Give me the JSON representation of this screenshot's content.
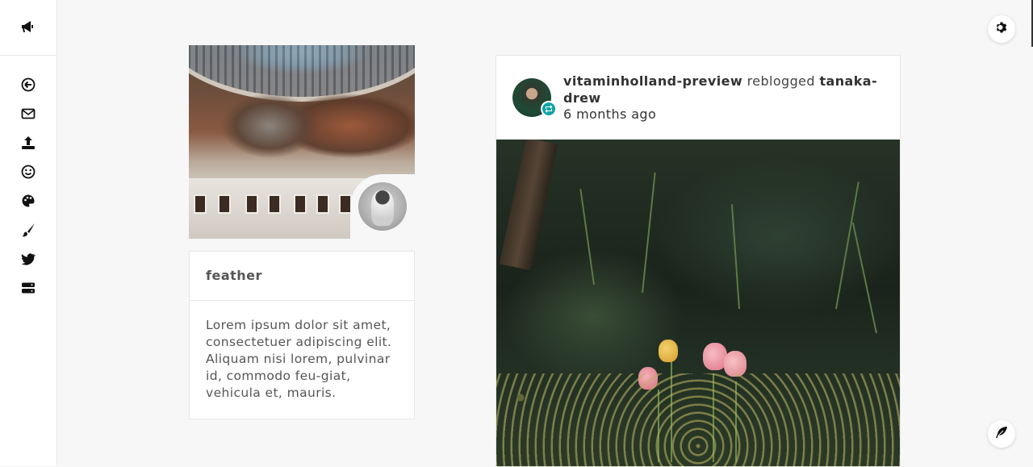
{
  "sidebar": {
    "top_icon": "megaphone-icon",
    "items": [
      {
        "icon": "back-arrow-icon"
      },
      {
        "icon": "envelope-icon"
      },
      {
        "icon": "upload-icon"
      },
      {
        "icon": "smiley-icon"
      },
      {
        "icon": "palette-icon"
      },
      {
        "icon": "paintbrush-icon"
      },
      {
        "icon": "bird-icon"
      },
      {
        "icon": "server-icon"
      }
    ]
  },
  "profile": {
    "name": "feather",
    "description": "Lorem ipsum dolor sit amet, consectetuer adipiscing elit. Aliquam nisi lorem, pulvinar id, commodo feu-giat, vehicula et, mauris."
  },
  "post": {
    "reblogger": "vitaminholland-preview",
    "action": "reblogged",
    "source": "tanaka-drew",
    "time": "6 months ago"
  },
  "colors": {
    "accent_teal": "#11a3a7",
    "background": "#f7f7f7",
    "sidebar_bg": "#ffffff"
  },
  "floating": {
    "settings_icon": "gear-icon",
    "compose_icon": "feather-icon"
  }
}
